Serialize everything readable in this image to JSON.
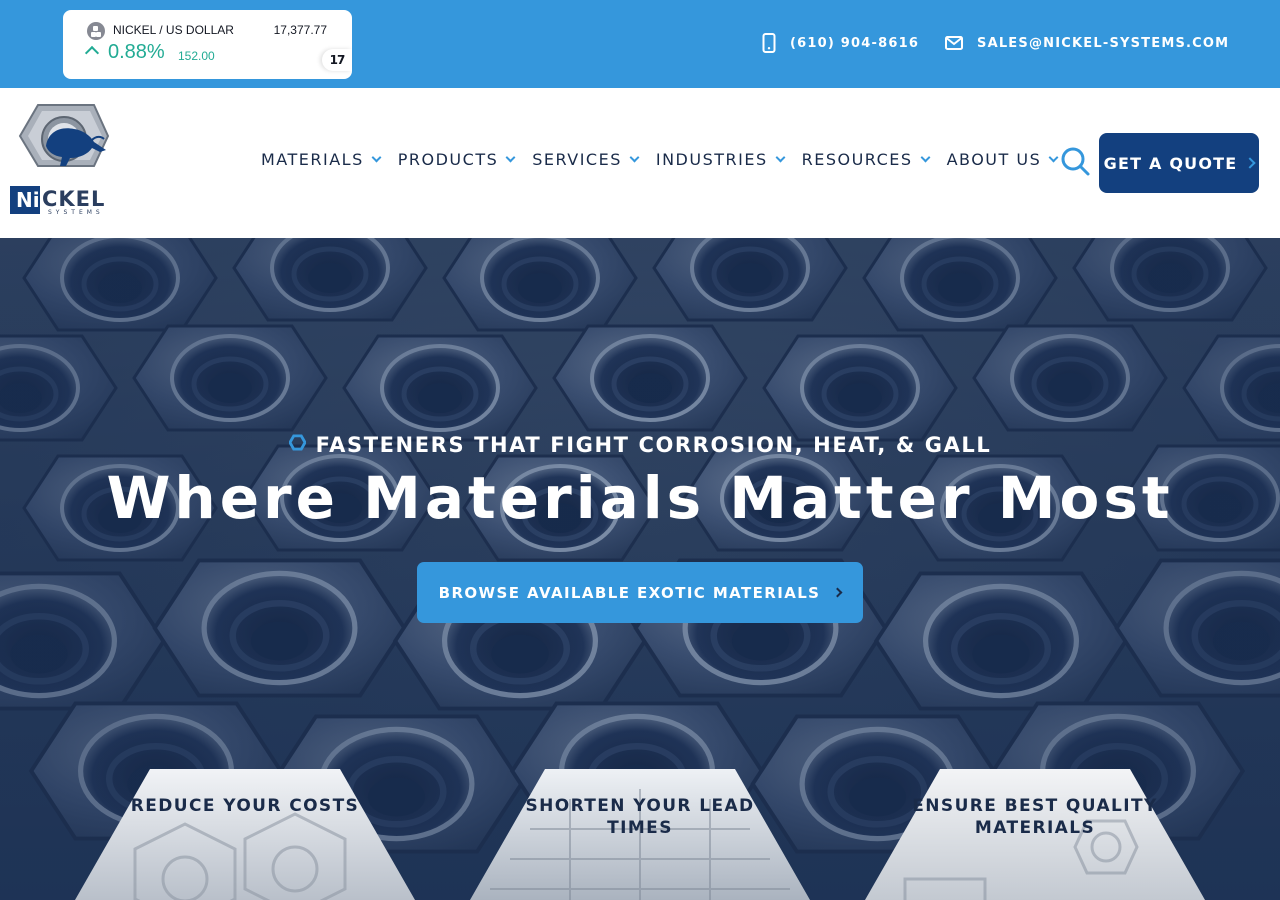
{
  "ticker": {
    "symbol": "NICKEL / US DOLLAR",
    "price": "17,377.77",
    "change_percent": "0.88%",
    "change_value": "152.00",
    "direction": "up",
    "badge": "17"
  },
  "contact": {
    "phone": "(610) 904-8616",
    "email": "SALES@NICKEL-SYSTEMS.COM",
    "phone_icon": "smartphone-icon",
    "email_icon": "envelope-icon"
  },
  "logo": {
    "mark_text": "Ni",
    "word_text": "CKEL",
    "sub_text": "SYSTEMS",
    "icon": "buffalo-hex-nut-logo"
  },
  "nav": {
    "items": [
      {
        "label": "MATERIALS"
      },
      {
        "label": "PRODUCTS"
      },
      {
        "label": "SERVICES"
      },
      {
        "label": "INDUSTRIES"
      },
      {
        "label": "RESOURCES"
      },
      {
        "label": "ABOUT US"
      }
    ],
    "search_icon": "search-icon",
    "quote_label": "GET A QUOTE"
  },
  "hero": {
    "kicker": "FASTENERS THAT FIGHT CORROSION, HEAT, & GALL",
    "headline": "Where Materials Matter Most",
    "cta_label": "BROWSE AVAILABLE EXOTIC MATERIALS"
  },
  "cards": [
    {
      "label": "REDUCE YOUR COSTS"
    },
    {
      "label": "SHORTEN YOUR LEAD TIMES"
    },
    {
      "label": "ENSURE BEST QUALITY MATERIALS"
    }
  ],
  "colors": {
    "topbar": "#3597dc",
    "navy": "#13407f",
    "text_dark": "#1a2b49",
    "accent": "#3597dc",
    "ticker_green": "#22ab94"
  }
}
